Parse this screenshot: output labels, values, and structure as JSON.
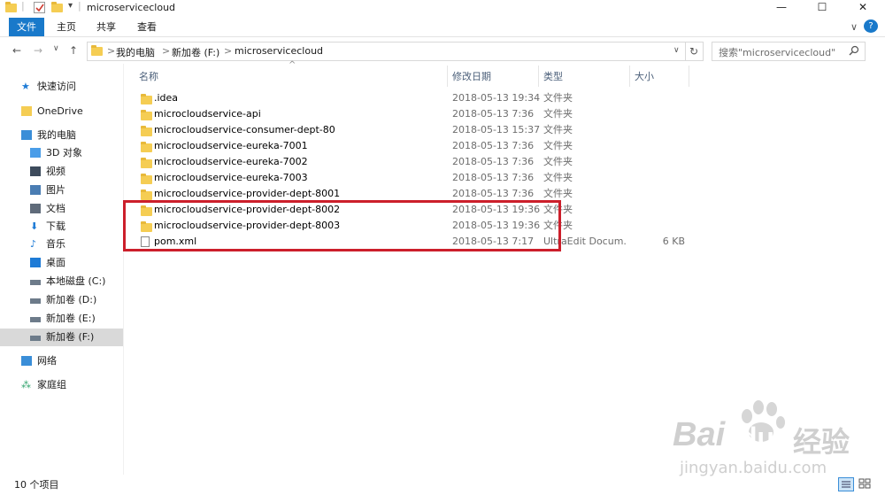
{
  "window": {
    "title": "microservicecloud",
    "quick_access_divider": "|",
    "qat_dropdown": "▾",
    "controls": {
      "minimize": "—",
      "maximize": "☐",
      "close": "✕"
    }
  },
  "ribbon": {
    "tabs": [
      "文件",
      "主页",
      "共享",
      "查看"
    ],
    "collapse": "∨",
    "help": "?"
  },
  "address": {
    "back": "←",
    "forward": "→",
    "recent": "∨",
    "up": "↑",
    "sep": ">",
    "crumbs": [
      "我的电脑",
      "新加卷 (F:)",
      "microservicecloud"
    ],
    "dropdown": "∨",
    "refresh": "↻"
  },
  "search": {
    "placeholder": "搜索\"microservicecloud\"",
    "icon": "search-icon"
  },
  "nav": {
    "items": [
      {
        "label": "快速访问",
        "icon": "star-icon",
        "color": "#1e7bd6"
      },
      {
        "label": "OneDrive",
        "icon": "folder-icon",
        "color": "#f5cd53"
      },
      {
        "label": "我的电脑",
        "icon": "computer-icon",
        "color": "#3a8ed8"
      },
      {
        "label": "3D 对象",
        "icon": "cube-icon",
        "color": "#4a9de8"
      },
      {
        "label": "视频",
        "icon": "video-icon",
        "color": "#3d4b5c"
      },
      {
        "label": "图片",
        "icon": "picture-icon",
        "color": "#4a7db3"
      },
      {
        "label": "文档",
        "icon": "document-icon",
        "color": "#5f6b7a"
      },
      {
        "label": "下载",
        "icon": "download-icon",
        "color": "#1e7bd6"
      },
      {
        "label": "音乐",
        "icon": "music-icon",
        "color": "#1e7bd6"
      },
      {
        "label": "桌面",
        "icon": "desktop-icon",
        "color": "#1e7bd6"
      },
      {
        "label": "本地磁盘 (C:)",
        "icon": "drive-icon",
        "color": "#6d7b8a"
      },
      {
        "label": "新加卷 (D:)",
        "icon": "drive-icon",
        "color": "#6d7b8a"
      },
      {
        "label": "新加卷 (E:)",
        "icon": "drive-icon",
        "color": "#6d7b8a"
      },
      {
        "label": "新加卷 (F:)",
        "icon": "drive-icon",
        "color": "#6d7b8a",
        "selected": true
      },
      {
        "label": "网络",
        "icon": "network-icon",
        "color": "#3a8ed8"
      },
      {
        "label": "家庭组",
        "icon": "homegroup-icon",
        "color": "#2fa36b"
      }
    ]
  },
  "columns": {
    "name": "名称",
    "date": "修改日期",
    "type": "类型",
    "size": "大小",
    "sort_indicator": "^"
  },
  "files": [
    {
      "name": ".idea",
      "date": "2018-05-13 19:34",
      "type": "文件夹",
      "size": "",
      "kind": "folder"
    },
    {
      "name": "microcloudservice-api",
      "date": "2018-05-13 7:36",
      "type": "文件夹",
      "size": "",
      "kind": "folder"
    },
    {
      "name": "microcloudservice-consumer-dept-80",
      "date": "2018-05-13 15:37",
      "type": "文件夹",
      "size": "",
      "kind": "folder"
    },
    {
      "name": "microcloudservice-eureka-7001",
      "date": "2018-05-13 7:36",
      "type": "文件夹",
      "size": "",
      "kind": "folder"
    },
    {
      "name": "microcloudservice-eureka-7002",
      "date": "2018-05-13 7:36",
      "type": "文件夹",
      "size": "",
      "kind": "folder"
    },
    {
      "name": "microcloudservice-eureka-7003",
      "date": "2018-05-13 7:36",
      "type": "文件夹",
      "size": "",
      "kind": "folder"
    },
    {
      "name": "microcloudservice-provider-dept-8001",
      "date": "2018-05-13 7:36",
      "type": "文件夹",
      "size": "",
      "kind": "folder"
    },
    {
      "name": "microcloudservice-provider-dept-8002",
      "date": "2018-05-13 19:36",
      "type": "文件夹",
      "size": "",
      "kind": "folder"
    },
    {
      "name": "microcloudservice-provider-dept-8003",
      "date": "2018-05-13 19:36",
      "type": "文件夹",
      "size": "",
      "kind": "folder"
    },
    {
      "name": "pom.xml",
      "date": "2018-05-13 7:17",
      "type": "UltraEdit Docum...",
      "size": "6 KB",
      "kind": "file"
    }
  ],
  "status": {
    "count": "10 个项目"
  },
  "watermark": {
    "brand": "Bai",
    "brand2": "du",
    "cn": "经验",
    "url": "jingyan.baidu.com"
  },
  "colors": {
    "accent": "#1979ca",
    "highlight": "#cc1f2b",
    "folder": "#f5cd53"
  }
}
